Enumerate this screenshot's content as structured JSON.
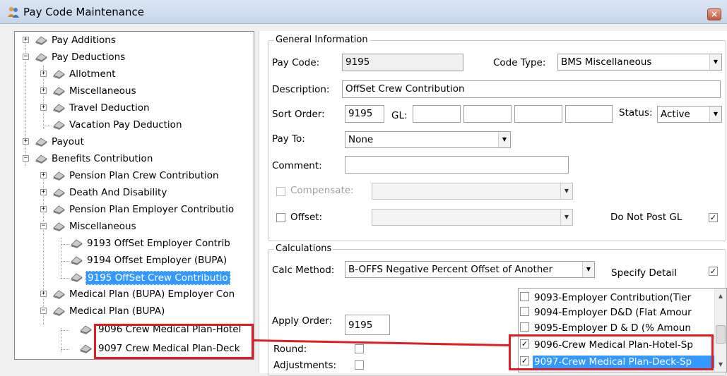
{
  "window": {
    "title": "Pay Code Maintenance",
    "close_glyph": "×",
    "icon": "people-icon"
  },
  "tree": {
    "nodes": [
      {
        "label": "Pay Additions",
        "expander": "+"
      },
      {
        "label": "Pay Deductions",
        "expander": "−"
      },
      {
        "label": "Allotment",
        "expander": "+"
      },
      {
        "label": "Miscellaneous",
        "expander": "+"
      },
      {
        "label": "Travel Deduction",
        "expander": "+"
      },
      {
        "label": "Vacation Pay Deduction",
        "expander": ""
      },
      {
        "label": "Payout",
        "expander": "+"
      },
      {
        "label": "Benefits Contribution",
        "expander": "−"
      },
      {
        "label": "Pension Plan Crew Contribution",
        "expander": "+"
      },
      {
        "label": "Death And Disability",
        "expander": "+"
      },
      {
        "label": "Pension Plan Employer Contributio",
        "expander": "+"
      },
      {
        "label": "Miscellaneous",
        "expander": "−"
      },
      {
        "label": "9193 OffSet Employer Contrib",
        "expander": ""
      },
      {
        "label": "9194 Offset Employer (BUPA)",
        "expander": ""
      },
      {
        "label": "9195 OffSet Crew Contributio",
        "expander": "",
        "selected": true
      },
      {
        "label": "Medical Plan (BUPA) Employer Con",
        "expander": "+"
      },
      {
        "label": "Medical Plan (BUPA)",
        "expander": "−"
      },
      {
        "label": "9096 Crew Medical Plan-Hotel",
        "expander": ""
      },
      {
        "label": "9097 Crew Medical Plan-Deck",
        "expander": ""
      }
    ]
  },
  "general": {
    "legend": "General Information",
    "pay_code_label": "Pay Code:",
    "pay_code": "9195",
    "code_type_label": "Code Type:",
    "code_type": "BMS Miscellaneous",
    "description_label": "Description:",
    "description": "OffSet Crew Contribution",
    "sort_order_label": "Sort Order:",
    "sort_order": "9195",
    "gl_label": "GL:",
    "status_label": "Status:",
    "status": "Active",
    "pay_to_label": "Pay To:",
    "pay_to": "None",
    "comment_label": "Comment:",
    "comment": "",
    "compensate_label": "Compensate:",
    "compensate_checked": false,
    "compensate_value": "",
    "offset_label": "Offset:",
    "offset_checked": false,
    "offset_value": "",
    "do_not_post_gl_label": "Do Not Post GL",
    "do_not_post_gl_checked": "✓"
  },
  "calculations": {
    "legend": "Calculations",
    "calc_method_label": "Calc Method:",
    "calc_method": "B-OFFS Negative Percent Offset of Another",
    "specify_detail_label": "Specify Detail",
    "specify_detail_checked": "✓",
    "apply_order_label": "Apply Order:",
    "apply_order": "9195",
    "round_label": "Round:",
    "adjustments_label": "Adjustments:",
    "items": [
      {
        "label": "9093-Employer Contribution(Tier",
        "checked": ""
      },
      {
        "label": "9094-Employer D&D (Flat Amour",
        "checked": ""
      },
      {
        "label": "9095-Employer D & D (% Amoun",
        "checked": ""
      },
      {
        "label": "9096-Crew Medical Plan-Hotel-Sp",
        "checked": "✓"
      },
      {
        "label": "9097-Crew Medical Plan-Deck-Sp",
        "checked": "✓",
        "selected": true
      }
    ]
  },
  "icons": {
    "dropdown": "▼",
    "scroll_up": "▲",
    "scroll_down": "▼"
  },
  "colors": {
    "selection": "#3399ff",
    "highlight": "#e01c24",
    "titlebar": "#c8d6ea"
  }
}
